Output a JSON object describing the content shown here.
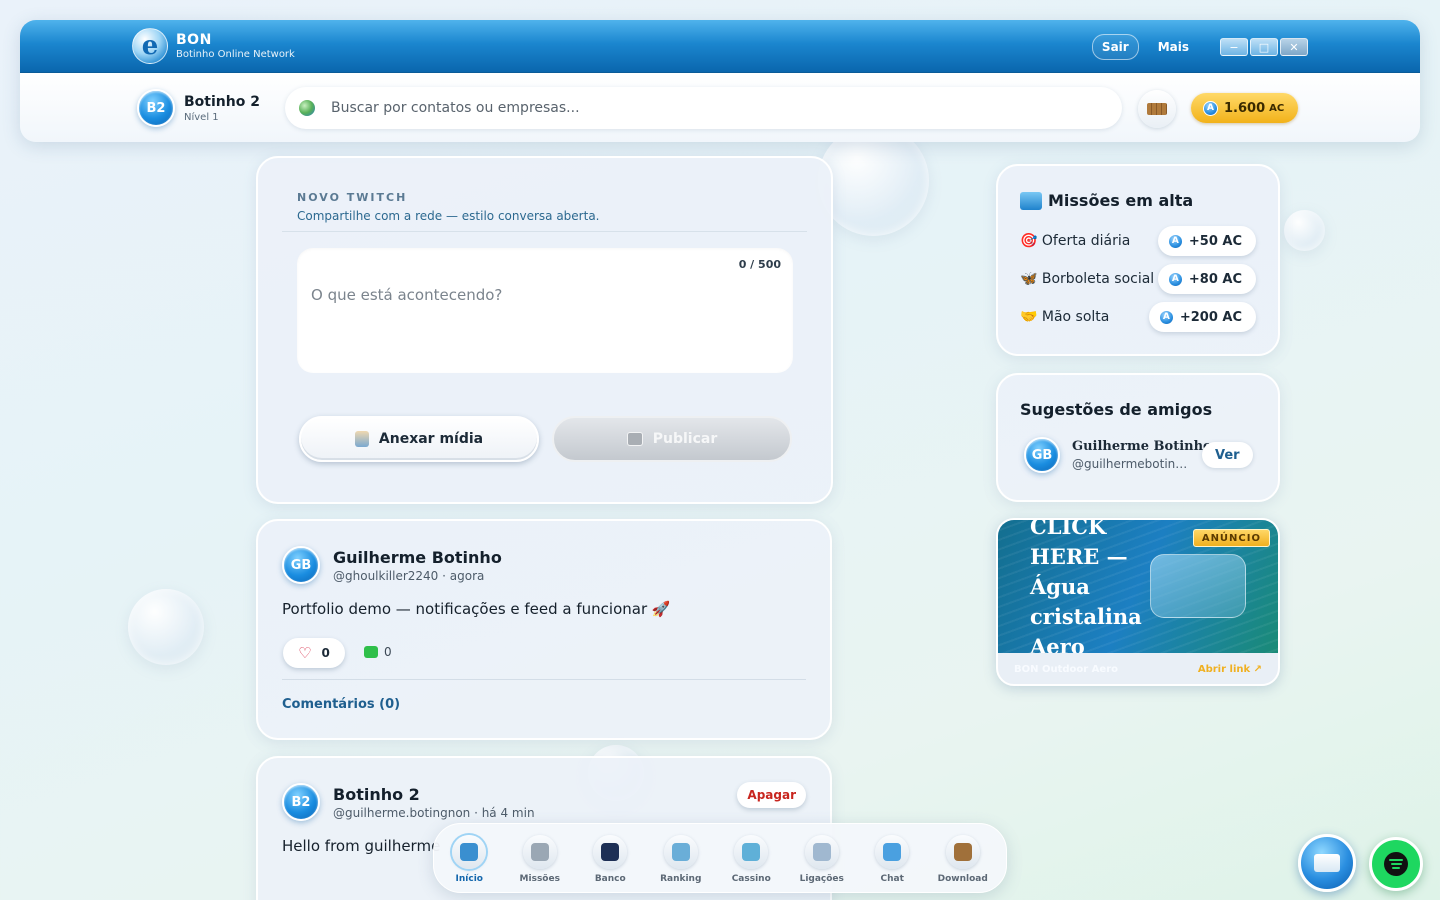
{
  "app": {
    "logo_letter": "e",
    "title": "BON",
    "subtitle": "Botinho Online Network",
    "actions": {
      "exit": "Sair",
      "more": "Mais"
    },
    "window_controls": {
      "minimize": "−",
      "maximize": "□",
      "close": "✕"
    }
  },
  "user": {
    "initials": "B2",
    "name": "Botinho 2",
    "level": "Nível 1"
  },
  "search": {
    "placeholder": "Buscar por contatos ou empresas..."
  },
  "wallet": {
    "amount": "1.600",
    "unit": "AC",
    "coin_letter": "A"
  },
  "composer": {
    "kicker": "NOVO TWITCH",
    "subtitle": "Compartilhe com a rede — estilo conversa aberta.",
    "counter": "0 / 500",
    "placeholder": "O que está acontecendo?",
    "attach_label": "Anexar mídia",
    "publish_label": "Publicar"
  },
  "posts": [
    {
      "initials": "GB",
      "author": "Guilherme Botinho",
      "handle_time": "@ghoulkiller2240 · agora",
      "text": "Portfolio demo — notificações e feed a funcionar 🚀",
      "likes": "0",
      "comments": "0",
      "comments_link": "Comentários (0)"
    },
    {
      "initials": "B2",
      "author": "Botinho 2",
      "handle_time": "@guilherme.botingnon · há 4 min",
      "text": "Hello from guilherme",
      "delete_label": "Apagar"
    }
  ],
  "missions": {
    "title": "Missões em alta",
    "items": [
      {
        "label": "🎯 Oferta diária",
        "reward": "+50 AC"
      },
      {
        "label": "🦋 Borboleta social",
        "reward": "+80 AC"
      },
      {
        "label": "🤝 Mão solta",
        "reward": "+200 AC"
      }
    ]
  },
  "friends": {
    "title": "Sugestões de amigos",
    "items": [
      {
        "initials": "GB",
        "name": "Guilherme Botinho",
        "handle": "@guilhermebotinho",
        "action": "Ver"
      }
    ]
  },
  "ad": {
    "headline": "CLICK HERE — Água cristalina Aero",
    "badge": "ANÚNCIO",
    "source": "BON Outdoor Aero",
    "link": "Abrir link ↗"
  },
  "dock": [
    {
      "label": "Início",
      "color": "#3a8fd0",
      "active": true
    },
    {
      "label": "Missões",
      "color": "#9aa7b4"
    },
    {
      "label": "Banco",
      "color": "#1d2f55"
    },
    {
      "label": "Ranking",
      "color": "#6aaed8"
    },
    {
      "label": "Cassino",
      "color": "#5fb0d8"
    },
    {
      "label": "Ligações",
      "color": "#a0b8d0"
    },
    {
      "label": "Chat",
      "color": "#4aa0e0"
    },
    {
      "label": "Download",
      "color": "#a0703a"
    }
  ],
  "colors": {
    "accent": "#1b86cf",
    "gold": "#f2b21a",
    "danger": "#c8261f",
    "spotify": "#1ed760"
  }
}
